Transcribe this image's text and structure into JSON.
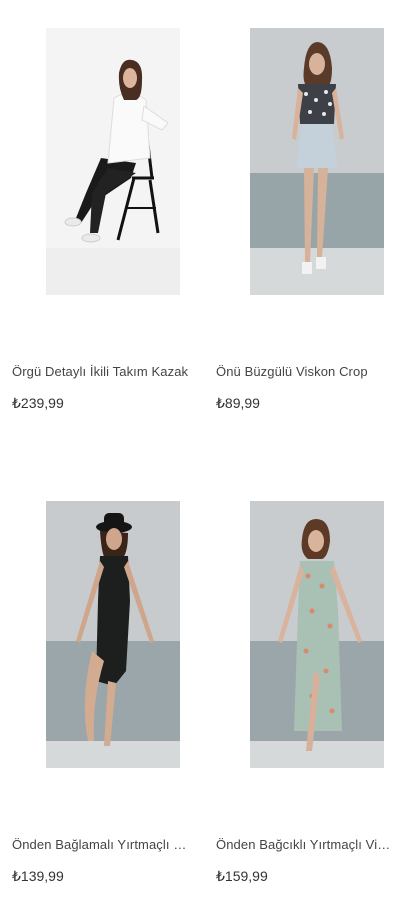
{
  "products": [
    {
      "name": "Örgü Detaylı İkili Takım Kazak",
      "price": "₺239,99",
      "image": "product-photo-white-sweater-black-jeans-chair"
    },
    {
      "name": "Önü Büzgülü Viskon Crop",
      "price": "₺89,99",
      "image": "product-photo-floral-crop-top-denim-skirt"
    },
    {
      "name": "Önden Bağlamalı Yırtmaçlı Kısa Elbise",
      "price": "₺139,99",
      "image": "product-photo-black-slit-dress-hat"
    },
    {
      "name": "Önden Bağcıklı Yırtmaçlı Viskon Elbise",
      "price": "₺159,99",
      "image": "product-photo-floral-slit-dress"
    }
  ]
}
